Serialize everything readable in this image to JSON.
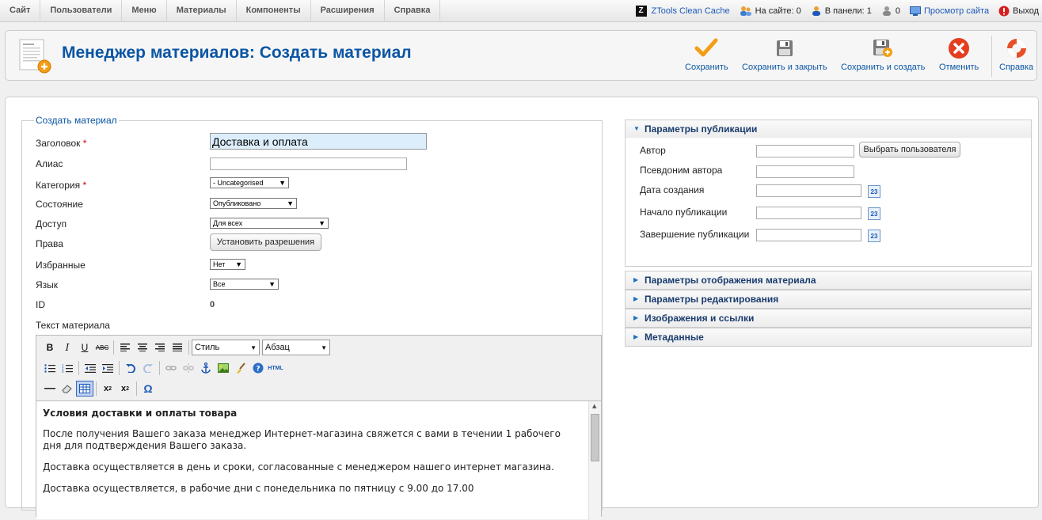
{
  "top_menu": {
    "items": [
      "Сайт",
      "Пользователи",
      "Меню",
      "Материалы",
      "Компоненты",
      "Расширения",
      "Справка"
    ]
  },
  "status": {
    "ztools_logo": "Z",
    "ztools": "ZTools Clean Cache",
    "on_site": "На сайте: 0",
    "in_panel": "В панели: 1",
    "messages": "0",
    "view_site": "Просмотр сайта",
    "logout": "Выход"
  },
  "header": {
    "title": "Менеджер материалов: Создать материал",
    "buttons": {
      "save": "Сохранить",
      "save_close": "Сохранить и закрыть",
      "save_new": "Сохранить и создать",
      "cancel": "Отменить",
      "help": "Справка"
    }
  },
  "form": {
    "legend": "Создать материал",
    "required_mark": "*",
    "title_label": "Заголовок",
    "title_value": "Доставка и оплата",
    "alias_label": "Алиас",
    "alias_value": "",
    "category_label": "Категория",
    "category_value": "- Uncategorised",
    "state_label": "Состояние",
    "state_value": "Опубликовано",
    "access_label": "Доступ",
    "access_value": "Для всех",
    "rights_label": "Права",
    "rights_button": "Установить разрешения",
    "featured_label": "Избранные",
    "featured_value": "Нет",
    "language_label": "Язык",
    "language_value": "Все",
    "id_label": "ID",
    "id_value": "0",
    "text_label": "Текст материала"
  },
  "editor": {
    "style_select": "Стиль",
    "format_select": "Абзац",
    "content": {
      "heading": "Условия доставки и оплаты товара",
      "p1": "После получения Вашего заказа менеджер Интернет-магазина свяжется с вами в течении 1 рабочего дня для подтверждения Вашего заказа.",
      "p2": "Доставка осуществляется в день и сроки, согласованные с менеджером нашего интернет магазина.",
      "p3": "Доставка осуществляется, в рабочие дни с понедельника по пятницу с 9.00 до 17.00"
    }
  },
  "publish": {
    "header": "Параметры публикации",
    "author_label": "Автор",
    "select_user_button": "Выбрать пользователя",
    "alias_label": "Псевдоним автора",
    "created_label": "Дата создания",
    "start_label": "Начало публикации",
    "end_label": "Завершение публикации",
    "calendar_icon_text": "23"
  },
  "sections": [
    "Параметры отображения материала",
    "Параметры редактирования",
    "Изображения и ссылки",
    "Метаданные"
  ],
  "colors": {
    "accent": "#0b55a4",
    "title_input_bg": "#dceefc",
    "cancel_red": "#e53d1f",
    "save_orange": "#f29d14"
  }
}
